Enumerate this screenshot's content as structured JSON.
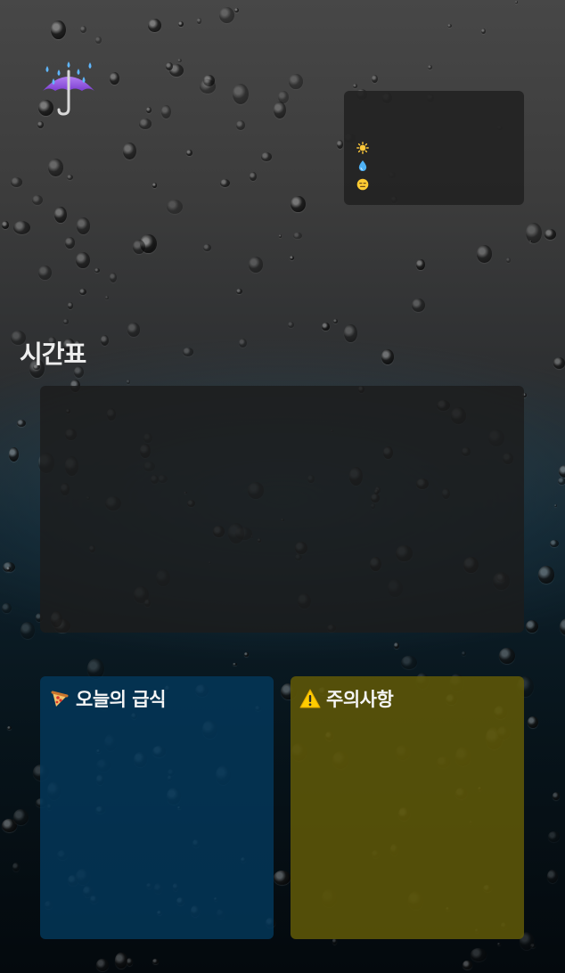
{
  "header": {
    "weather_icon": "umbrella-with-rain-icon"
  },
  "weather_card": {
    "rows": [
      {
        "icon": "sun-icon"
      },
      {
        "icon": "droplet-icon"
      },
      {
        "icon": "neutral-face-icon"
      }
    ]
  },
  "timetable": {
    "title": "시간표"
  },
  "meal": {
    "icon": "pizza-icon",
    "title": "오늘의 급식"
  },
  "notice": {
    "icon": "warning-icon",
    "title": "주의사항"
  },
  "colors": {
    "meal_card": "#04385c",
    "notice_card": "#5e5808",
    "panel": "#232323"
  }
}
